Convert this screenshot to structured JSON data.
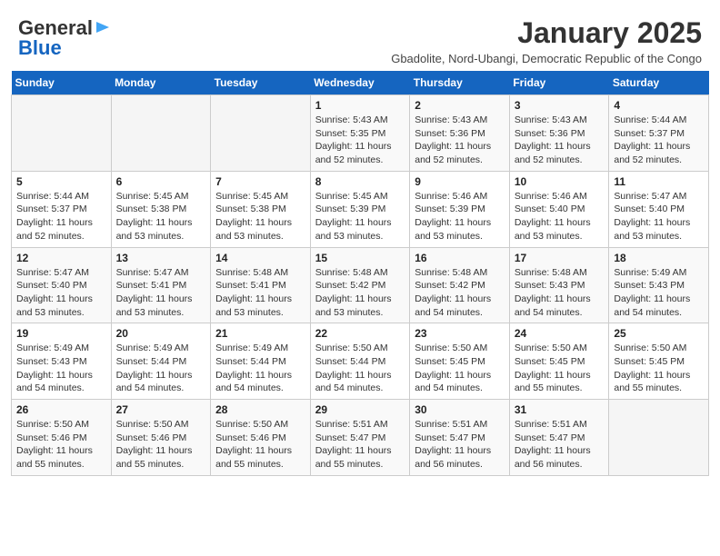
{
  "header": {
    "logo_general": "General",
    "logo_blue": "Blue",
    "month_title": "January 2025",
    "subtitle": "Gbadolite, Nord-Ubangi, Democratic Republic of the Congo"
  },
  "days_of_week": [
    "Sunday",
    "Monday",
    "Tuesday",
    "Wednesday",
    "Thursday",
    "Friday",
    "Saturday"
  ],
  "weeks": [
    [
      {
        "num": "",
        "info": ""
      },
      {
        "num": "",
        "info": ""
      },
      {
        "num": "",
        "info": ""
      },
      {
        "num": "1",
        "info": "Sunrise: 5:43 AM\nSunset: 5:35 PM\nDaylight: 11 hours\nand 52 minutes."
      },
      {
        "num": "2",
        "info": "Sunrise: 5:43 AM\nSunset: 5:36 PM\nDaylight: 11 hours\nand 52 minutes."
      },
      {
        "num": "3",
        "info": "Sunrise: 5:43 AM\nSunset: 5:36 PM\nDaylight: 11 hours\nand 52 minutes."
      },
      {
        "num": "4",
        "info": "Sunrise: 5:44 AM\nSunset: 5:37 PM\nDaylight: 11 hours\nand 52 minutes."
      }
    ],
    [
      {
        "num": "5",
        "info": "Sunrise: 5:44 AM\nSunset: 5:37 PM\nDaylight: 11 hours\nand 52 minutes."
      },
      {
        "num": "6",
        "info": "Sunrise: 5:45 AM\nSunset: 5:38 PM\nDaylight: 11 hours\nand 53 minutes."
      },
      {
        "num": "7",
        "info": "Sunrise: 5:45 AM\nSunset: 5:38 PM\nDaylight: 11 hours\nand 53 minutes."
      },
      {
        "num": "8",
        "info": "Sunrise: 5:45 AM\nSunset: 5:39 PM\nDaylight: 11 hours\nand 53 minutes."
      },
      {
        "num": "9",
        "info": "Sunrise: 5:46 AM\nSunset: 5:39 PM\nDaylight: 11 hours\nand 53 minutes."
      },
      {
        "num": "10",
        "info": "Sunrise: 5:46 AM\nSunset: 5:40 PM\nDaylight: 11 hours\nand 53 minutes."
      },
      {
        "num": "11",
        "info": "Sunrise: 5:47 AM\nSunset: 5:40 PM\nDaylight: 11 hours\nand 53 minutes."
      }
    ],
    [
      {
        "num": "12",
        "info": "Sunrise: 5:47 AM\nSunset: 5:40 PM\nDaylight: 11 hours\nand 53 minutes."
      },
      {
        "num": "13",
        "info": "Sunrise: 5:47 AM\nSunset: 5:41 PM\nDaylight: 11 hours\nand 53 minutes."
      },
      {
        "num": "14",
        "info": "Sunrise: 5:48 AM\nSunset: 5:41 PM\nDaylight: 11 hours\nand 53 minutes."
      },
      {
        "num": "15",
        "info": "Sunrise: 5:48 AM\nSunset: 5:42 PM\nDaylight: 11 hours\nand 53 minutes."
      },
      {
        "num": "16",
        "info": "Sunrise: 5:48 AM\nSunset: 5:42 PM\nDaylight: 11 hours\nand 54 minutes."
      },
      {
        "num": "17",
        "info": "Sunrise: 5:48 AM\nSunset: 5:43 PM\nDaylight: 11 hours\nand 54 minutes."
      },
      {
        "num": "18",
        "info": "Sunrise: 5:49 AM\nSunset: 5:43 PM\nDaylight: 11 hours\nand 54 minutes."
      }
    ],
    [
      {
        "num": "19",
        "info": "Sunrise: 5:49 AM\nSunset: 5:43 PM\nDaylight: 11 hours\nand 54 minutes."
      },
      {
        "num": "20",
        "info": "Sunrise: 5:49 AM\nSunset: 5:44 PM\nDaylight: 11 hours\nand 54 minutes."
      },
      {
        "num": "21",
        "info": "Sunrise: 5:49 AM\nSunset: 5:44 PM\nDaylight: 11 hours\nand 54 minutes."
      },
      {
        "num": "22",
        "info": "Sunrise: 5:50 AM\nSunset: 5:44 PM\nDaylight: 11 hours\nand 54 minutes."
      },
      {
        "num": "23",
        "info": "Sunrise: 5:50 AM\nSunset: 5:45 PM\nDaylight: 11 hours\nand 54 minutes."
      },
      {
        "num": "24",
        "info": "Sunrise: 5:50 AM\nSunset: 5:45 PM\nDaylight: 11 hours\nand 55 minutes."
      },
      {
        "num": "25",
        "info": "Sunrise: 5:50 AM\nSunset: 5:45 PM\nDaylight: 11 hours\nand 55 minutes."
      }
    ],
    [
      {
        "num": "26",
        "info": "Sunrise: 5:50 AM\nSunset: 5:46 PM\nDaylight: 11 hours\nand 55 minutes."
      },
      {
        "num": "27",
        "info": "Sunrise: 5:50 AM\nSunset: 5:46 PM\nDaylight: 11 hours\nand 55 minutes."
      },
      {
        "num": "28",
        "info": "Sunrise: 5:50 AM\nSunset: 5:46 PM\nDaylight: 11 hours\nand 55 minutes."
      },
      {
        "num": "29",
        "info": "Sunrise: 5:51 AM\nSunset: 5:47 PM\nDaylight: 11 hours\nand 55 minutes."
      },
      {
        "num": "30",
        "info": "Sunrise: 5:51 AM\nSunset: 5:47 PM\nDaylight: 11 hours\nand 56 minutes."
      },
      {
        "num": "31",
        "info": "Sunrise: 5:51 AM\nSunset: 5:47 PM\nDaylight: 11 hours\nand 56 minutes."
      },
      {
        "num": "",
        "info": ""
      }
    ]
  ]
}
